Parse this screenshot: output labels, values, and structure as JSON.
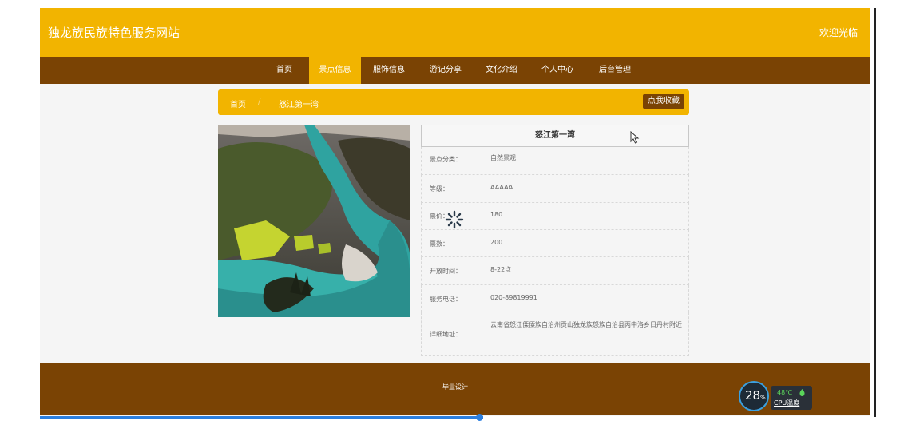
{
  "header": {
    "site_title": "独龙族民族特色服务网站",
    "welcome": "欢迎光临"
  },
  "nav": {
    "items": [
      {
        "label": "首页",
        "active": false
      },
      {
        "label": "景点信息",
        "active": true
      },
      {
        "label": "服饰信息",
        "active": false
      },
      {
        "label": "游记分享",
        "active": false
      },
      {
        "label": "文化介绍",
        "active": false
      },
      {
        "label": "个人中心",
        "active": false
      },
      {
        "label": "后台管理",
        "active": false
      }
    ]
  },
  "breadcrumb": {
    "home": "首页",
    "separator": "/",
    "current": "怒江第一湾",
    "favorite_button": "点我收藏"
  },
  "detail": {
    "title": "怒江第一湾",
    "rows": [
      {
        "label": "景点分类：",
        "value": "自然景观"
      },
      {
        "label": "等级：",
        "value": "AAAAA"
      },
      {
        "label": "票价：",
        "value": "180"
      },
      {
        "label": "票数：",
        "value": "200"
      },
      {
        "label": "开放时间：",
        "value": "8-22点"
      },
      {
        "label": "服务电话：",
        "value": "020-89819991"
      },
      {
        "label": "详细地址：",
        "value": "云南省怒江傈僳族自治州贡山独龙族怒族自治县丙中洛乡日丹村附近"
      }
    ]
  },
  "footer": {
    "text": "毕业设计"
  },
  "cpu_widget": {
    "usage_number": "28",
    "usage_unit": "%",
    "temperature": "48℃",
    "label": "CPU温度"
  },
  "colors": {
    "accent_yellow": "#f2b400",
    "brown": "#7a4304",
    "scroll_blue": "#2b7fe0"
  },
  "icons": {
    "cursor": "mouse-pointer-icon",
    "spinner": "loading-spinner-icon",
    "drop": "water-drop-icon"
  }
}
